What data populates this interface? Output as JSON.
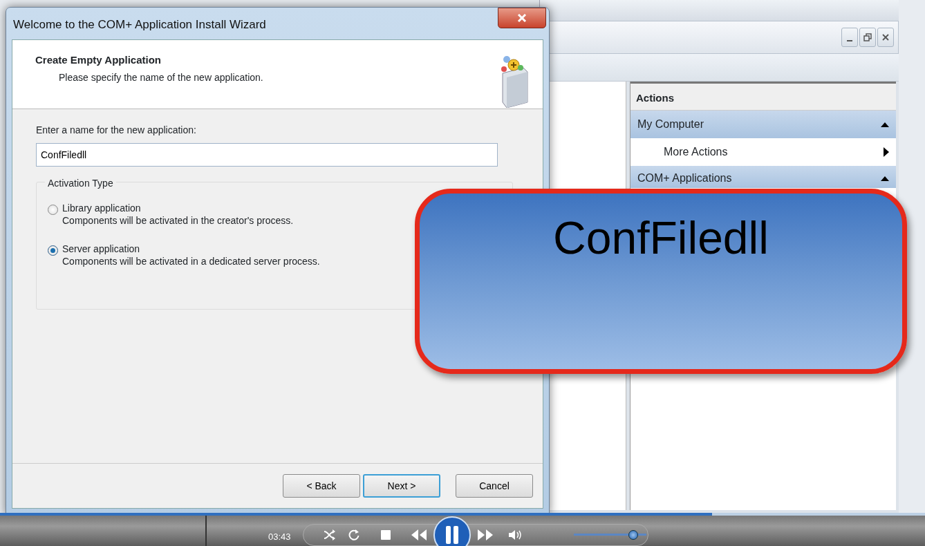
{
  "wizard": {
    "title": "Welcome to the COM+ Application Install Wizard",
    "heading": "Create Empty Application",
    "subheading": "Please specify the name of the new application.",
    "name_label": "Enter a name for the new application:",
    "name_value": "ConfFiledll",
    "group_title": "Activation Type",
    "options": [
      {
        "label": "Library application",
        "description": "Components will be activated in the creator's process.",
        "selected": false
      },
      {
        "label": "Server application",
        "description": "Components will be activated in a dedicated server process.",
        "selected": true
      }
    ],
    "buttons": [
      {
        "label": "< Back",
        "default": false
      },
      {
        "label": "Next >",
        "default": true
      },
      {
        "label": "Cancel",
        "default": false
      }
    ]
  },
  "actions_pane": {
    "title": "Actions",
    "sections": [
      {
        "label": "My Computer",
        "expanded": true,
        "items": [
          {
            "label": "More Actions"
          }
        ]
      },
      {
        "label": "COM+ Applications",
        "expanded": true
      }
    ]
  },
  "callout": {
    "text": "ConfFiledll"
  },
  "player": {
    "time": "03:43",
    "progress": {
      "level": 0.77
    },
    "volume": {
      "level": 0.78
    }
  }
}
